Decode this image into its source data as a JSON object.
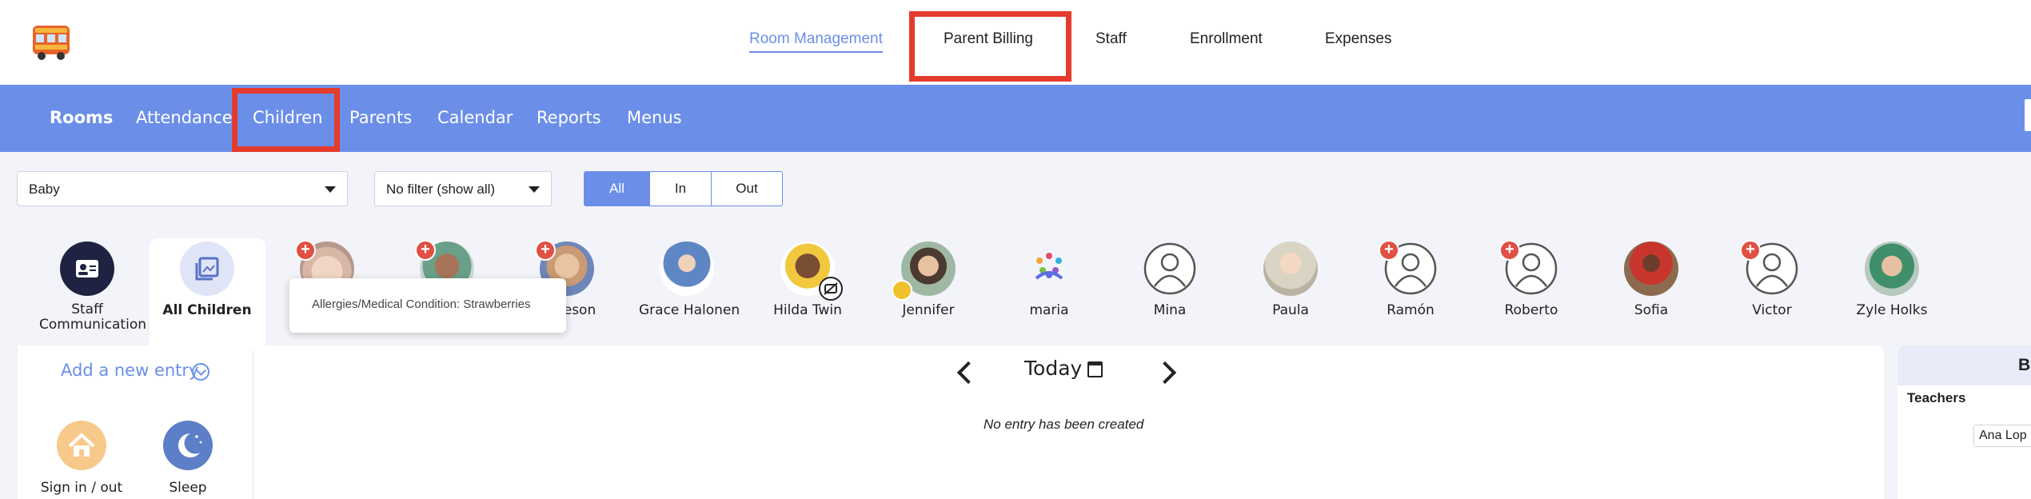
{
  "top_nav": {
    "items": [
      {
        "label": "Room Management",
        "active": true
      },
      {
        "label": "Parent Billing",
        "active": false
      },
      {
        "label": "Staff",
        "active": false
      },
      {
        "label": "Enrollment",
        "active": false
      },
      {
        "label": "Expenses",
        "active": false
      }
    ]
  },
  "sub_nav": {
    "items": [
      {
        "label": "Rooms",
        "active": true
      },
      {
        "label": "Attendance",
        "active": false
      },
      {
        "label": "Children",
        "active": false
      },
      {
        "label": "Parents",
        "active": false
      },
      {
        "label": "Calendar",
        "active": false
      },
      {
        "label": "Reports",
        "active": false
      },
      {
        "label": "Menus",
        "active": false
      }
    ]
  },
  "filters": {
    "room_select": "Baby",
    "status_select": "No filter (show all)",
    "segments": [
      {
        "label": "All",
        "selected": true
      },
      {
        "label": "In",
        "selected": false
      },
      {
        "label": "Out",
        "selected": false
      }
    ]
  },
  "children_strip": {
    "staff_communication": "Staff Communication",
    "all_children": "All Children",
    "children": [
      {
        "name": "",
        "alert": true
      },
      {
        "name": "",
        "alert": true
      },
      {
        "name": "Jameson",
        "alert": true
      },
      {
        "name": "Grace Halonen",
        "alert": false
      },
      {
        "name": "Hilda Twin",
        "alert": false
      },
      {
        "name": "Jennifer",
        "alert": false
      },
      {
        "name": "maria",
        "alert": false
      },
      {
        "name": "Mina",
        "alert": false
      },
      {
        "name": "Paula",
        "alert": false
      },
      {
        "name": "Ramón",
        "alert": true
      },
      {
        "name": "Roberto",
        "alert": true
      },
      {
        "name": "Sofia",
        "alert": false
      },
      {
        "name": "Victor",
        "alert": true
      },
      {
        "name": "Zyle Holks",
        "alert": false
      }
    ],
    "tooltip": "Allergies/Medical Condition: Strawberries"
  },
  "entries": {
    "add_new_entry": "Add a new entry",
    "actions": [
      {
        "label": "Sign in / out",
        "icon": "home-icon",
        "color": "#f7c98a"
      },
      {
        "label": "Sleep",
        "icon": "moon-icon",
        "color": "#5c7fc7"
      }
    ]
  },
  "day_view": {
    "date_label": "Today",
    "empty_message": "No entry has been created"
  },
  "right_panel": {
    "header": "Ba",
    "teachers_label": "Teachers",
    "teacher_value": "Ana Lop"
  },
  "colors": {
    "accent": "#6b8fe8",
    "highlight": "#e53b2c",
    "alert": "#e05044"
  }
}
